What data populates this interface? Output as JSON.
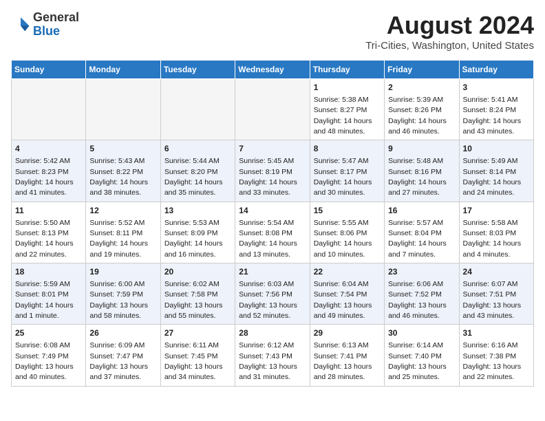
{
  "header": {
    "logo_general": "General",
    "logo_blue": "Blue",
    "main_title": "August 2024",
    "subtitle": "Tri-Cities, Washington, United States"
  },
  "calendar": {
    "days_of_week": [
      "Sunday",
      "Monday",
      "Tuesday",
      "Wednesday",
      "Thursday",
      "Friday",
      "Saturday"
    ],
    "weeks": [
      [
        {
          "day": "",
          "empty": true
        },
        {
          "day": "",
          "empty": true
        },
        {
          "day": "",
          "empty": true
        },
        {
          "day": "",
          "empty": true
        },
        {
          "day": "1",
          "sunrise": "5:38 AM",
          "sunset": "8:27 PM",
          "daylight": "14 hours and 48 minutes."
        },
        {
          "day": "2",
          "sunrise": "5:39 AM",
          "sunset": "8:26 PM",
          "daylight": "14 hours and 46 minutes."
        },
        {
          "day": "3",
          "sunrise": "5:41 AM",
          "sunset": "8:24 PM",
          "daylight": "14 hours and 43 minutes."
        }
      ],
      [
        {
          "day": "4",
          "sunrise": "5:42 AM",
          "sunset": "8:23 PM",
          "daylight": "14 hours and 41 minutes."
        },
        {
          "day": "5",
          "sunrise": "5:43 AM",
          "sunset": "8:22 PM",
          "daylight": "14 hours and 38 minutes."
        },
        {
          "day": "6",
          "sunrise": "5:44 AM",
          "sunset": "8:20 PM",
          "daylight": "14 hours and 35 minutes."
        },
        {
          "day": "7",
          "sunrise": "5:45 AM",
          "sunset": "8:19 PM",
          "daylight": "14 hours and 33 minutes."
        },
        {
          "day": "8",
          "sunrise": "5:47 AM",
          "sunset": "8:17 PM",
          "daylight": "14 hours and 30 minutes."
        },
        {
          "day": "9",
          "sunrise": "5:48 AM",
          "sunset": "8:16 PM",
          "daylight": "14 hours and 27 minutes."
        },
        {
          "day": "10",
          "sunrise": "5:49 AM",
          "sunset": "8:14 PM",
          "daylight": "14 hours and 24 minutes."
        }
      ],
      [
        {
          "day": "11",
          "sunrise": "5:50 AM",
          "sunset": "8:13 PM",
          "daylight": "14 hours and 22 minutes."
        },
        {
          "day": "12",
          "sunrise": "5:52 AM",
          "sunset": "8:11 PM",
          "daylight": "14 hours and 19 minutes."
        },
        {
          "day": "13",
          "sunrise": "5:53 AM",
          "sunset": "8:09 PM",
          "daylight": "14 hours and 16 minutes."
        },
        {
          "day": "14",
          "sunrise": "5:54 AM",
          "sunset": "8:08 PM",
          "daylight": "14 hours and 13 minutes."
        },
        {
          "day": "15",
          "sunrise": "5:55 AM",
          "sunset": "8:06 PM",
          "daylight": "14 hours and 10 minutes."
        },
        {
          "day": "16",
          "sunrise": "5:57 AM",
          "sunset": "8:04 PM",
          "daylight": "14 hours and 7 minutes."
        },
        {
          "day": "17",
          "sunrise": "5:58 AM",
          "sunset": "8:03 PM",
          "daylight": "14 hours and 4 minutes."
        }
      ],
      [
        {
          "day": "18",
          "sunrise": "5:59 AM",
          "sunset": "8:01 PM",
          "daylight": "14 hours and 1 minute."
        },
        {
          "day": "19",
          "sunrise": "6:00 AM",
          "sunset": "7:59 PM",
          "daylight": "13 hours and 58 minutes."
        },
        {
          "day": "20",
          "sunrise": "6:02 AM",
          "sunset": "7:58 PM",
          "daylight": "13 hours and 55 minutes."
        },
        {
          "day": "21",
          "sunrise": "6:03 AM",
          "sunset": "7:56 PM",
          "daylight": "13 hours and 52 minutes."
        },
        {
          "day": "22",
          "sunrise": "6:04 AM",
          "sunset": "7:54 PM",
          "daylight": "13 hours and 49 minutes."
        },
        {
          "day": "23",
          "sunrise": "6:06 AM",
          "sunset": "7:52 PM",
          "daylight": "13 hours and 46 minutes."
        },
        {
          "day": "24",
          "sunrise": "6:07 AM",
          "sunset": "7:51 PM",
          "daylight": "13 hours and 43 minutes."
        }
      ],
      [
        {
          "day": "25",
          "sunrise": "6:08 AM",
          "sunset": "7:49 PM",
          "daylight": "13 hours and 40 minutes."
        },
        {
          "day": "26",
          "sunrise": "6:09 AM",
          "sunset": "7:47 PM",
          "daylight": "13 hours and 37 minutes."
        },
        {
          "day": "27",
          "sunrise": "6:11 AM",
          "sunset": "7:45 PM",
          "daylight": "13 hours and 34 minutes."
        },
        {
          "day": "28",
          "sunrise": "6:12 AM",
          "sunset": "7:43 PM",
          "daylight": "13 hours and 31 minutes."
        },
        {
          "day": "29",
          "sunrise": "6:13 AM",
          "sunset": "7:41 PM",
          "daylight": "13 hours and 28 minutes."
        },
        {
          "day": "30",
          "sunrise": "6:14 AM",
          "sunset": "7:40 PM",
          "daylight": "13 hours and 25 minutes."
        },
        {
          "day": "31",
          "sunrise": "6:16 AM",
          "sunset": "7:38 PM",
          "daylight": "13 hours and 22 minutes."
        }
      ]
    ]
  }
}
